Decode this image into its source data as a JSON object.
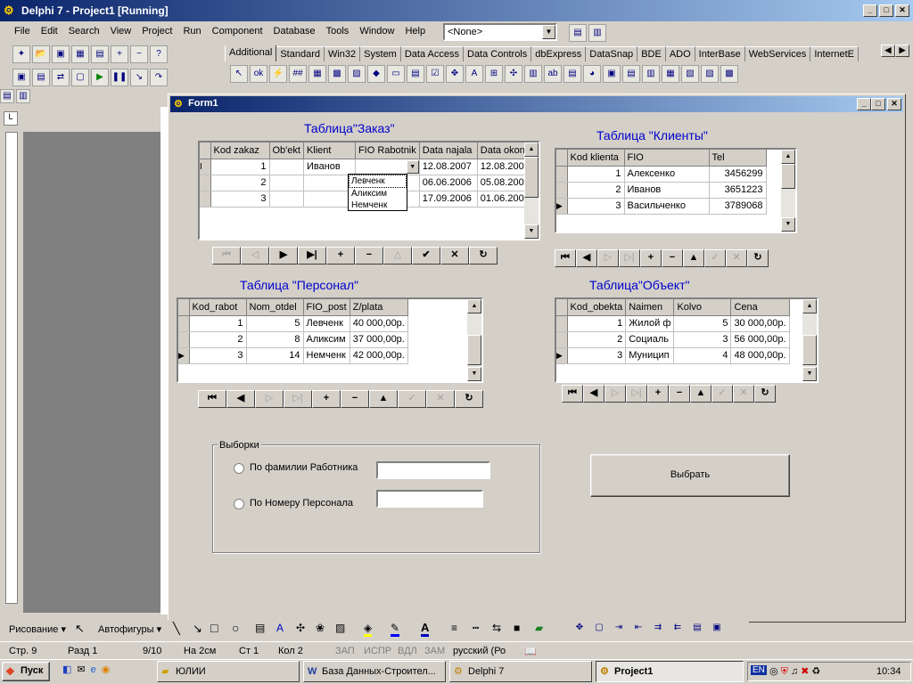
{
  "ide": {
    "title": "Delphi 7 - Project1 [Running]",
    "menu": [
      "File",
      "Edit",
      "Search",
      "View",
      "Project",
      "Run",
      "Component",
      "Database",
      "Tools",
      "Window",
      "Help"
    ],
    "combo_value": "<None>",
    "palette_tabs": [
      "Additional",
      "Standard",
      "Win32",
      "System",
      "Data Access",
      "Data Controls",
      "dbExpress",
      "DataSnap",
      "BDE",
      "ADO",
      "InterBase",
      "WebServices",
      "InternetE"
    ]
  },
  "form": {
    "title": "Form1",
    "zakaz": {
      "title": "Таблица\"Заказ\"",
      "columns": [
        "Kod zakaz",
        "Ob'ekt",
        "Klient",
        "FIO Rabotnik",
        "Data najala",
        "Data okonj"
      ],
      "rows": [
        [
          "1",
          "",
          "Иванов",
          "",
          "12.08.2007",
          "12.08.2008"
        ],
        [
          "2",
          "",
          "",
          "",
          "06.06.2006",
          "05.08.2007"
        ],
        [
          "3",
          "",
          "",
          "",
          "17.09.2006",
          "01.06.2007"
        ]
      ],
      "dropdown": [
        "Левченк",
        "Аликсим",
        "Немченк"
      ]
    },
    "klienty": {
      "title": "Таблица \"Клиенты\"",
      "columns": [
        "Kod klienta",
        "FIO",
        "Tel"
      ],
      "rows": [
        [
          "1",
          "Алексенко",
          "3456299"
        ],
        [
          "2",
          "Иванов",
          "3651223"
        ],
        [
          "3",
          "Васильченко",
          "3789068"
        ]
      ]
    },
    "personal": {
      "title": "Таблица \"Персонал\"",
      "columns": [
        "Kod_rabot",
        "Nom_otdel",
        "FIO_post",
        "Z/plata"
      ],
      "rows": [
        [
          "1",
          "5",
          "Левченк",
          "40 000,00р."
        ],
        [
          "2",
          "8",
          "Аликсим",
          "37 000,00р."
        ],
        [
          "3",
          "14",
          "Немченк",
          "42 000,00р."
        ]
      ]
    },
    "obekt": {
      "title": "Таблица\"Объект\"",
      "columns": [
        "Kod_obekta",
        "Naimen",
        "Kolvo",
        "Cena"
      ],
      "rows": [
        [
          "1",
          "Жилой ф",
          "5",
          "30 000,00р."
        ],
        [
          "2",
          "Социаль",
          "3",
          "56 000,00р."
        ],
        [
          "3",
          "Муницип",
          "4",
          "48 000,00р."
        ]
      ]
    },
    "vyborki": {
      "group_label": "Выборки",
      "option1": "По фамилии Работника",
      "option2": "По Номеру Персонала"
    },
    "select_button": "Выбрать"
  },
  "word": {
    "drawing_label": "Рисование ▾",
    "autoshapes_label": "Автофигуры ▾",
    "status": [
      "Стр. 9",
      "Разд 1",
      "9/10",
      "На 2см",
      "Ст 1",
      "Кол 2",
      "ЗАП",
      "ИСПР",
      "ВДЛ",
      "ЗАМ",
      "русский (Ро"
    ]
  },
  "taskbar": {
    "start": "Пуск",
    "buttons": [
      "ЮЛИИ",
      "База Данных-Строител...",
      "Delphi 7",
      "Project1"
    ],
    "lang": "EN",
    "time": "10:34"
  }
}
